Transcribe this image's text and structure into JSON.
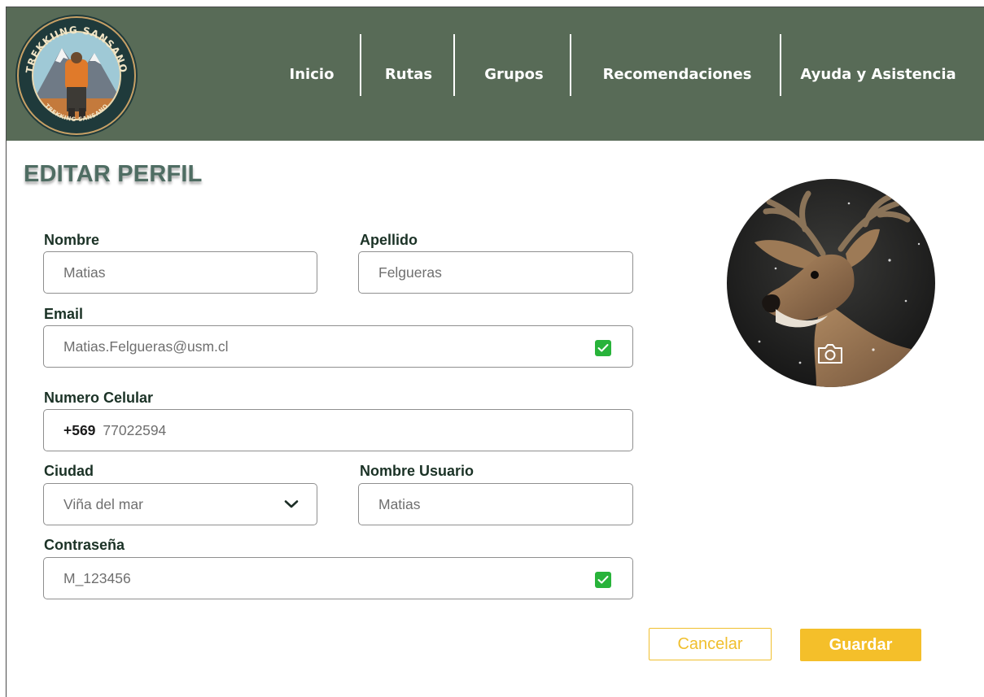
{
  "header": {
    "logo_text": "TREKKIING SANSANO",
    "logo_subtext": "TREKKING SANSANO",
    "nav": [
      "Inicio",
      "Rutas",
      "Grupos",
      "Recomendaciones",
      "Ayuda y Asistencia"
    ],
    "background_color": "#586b57"
  },
  "page": {
    "title": "EDITAR PERFIL"
  },
  "form": {
    "nombre": {
      "label": "Nombre",
      "value": "Matias"
    },
    "apellido": {
      "label": "Apellido",
      "value": "Felgueras"
    },
    "email": {
      "label": "Email",
      "value": "Matias.Felgueras@usm.cl",
      "verified": true
    },
    "celular": {
      "label": "Numero Celular",
      "prefix": "+569",
      "value": "77022594"
    },
    "ciudad": {
      "label": "Ciudad",
      "value": "Viña del mar"
    },
    "usuario": {
      "label": "Nombre Usuario",
      "value": "Matias"
    },
    "contrasena": {
      "label": "Contraseña",
      "value": "M_123456",
      "verified": true
    }
  },
  "avatar": {
    "icon": "camera-icon"
  },
  "actions": {
    "cancel_label": "Cancelar",
    "save_label": "Guardar",
    "accent_color": "#f4bf2a"
  }
}
